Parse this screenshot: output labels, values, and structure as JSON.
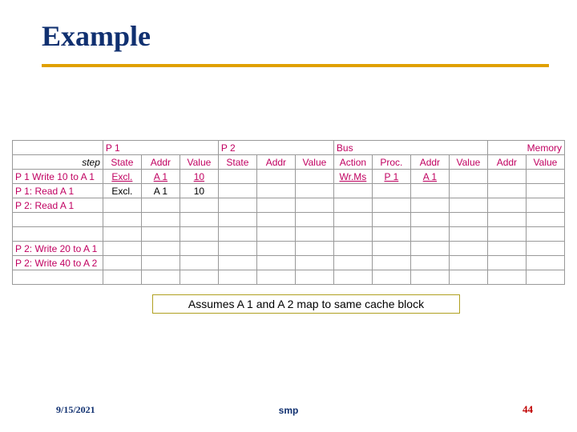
{
  "title": "Example",
  "group_headers": {
    "pre": "",
    "p1": "P 1",
    "p2": "P 2",
    "bus": "Bus",
    "mem": "Memory"
  },
  "col_headers": {
    "step": "step",
    "p1_state": "State",
    "p1_addr": "Addr",
    "p1_value": "Value",
    "p2_state": "State",
    "p2_addr": "Addr",
    "p2_value": "Value",
    "bus_action": "Action",
    "bus_proc": "Proc.",
    "bus_addr": "Addr",
    "bus_value": "Value",
    "mem_addr": "Addr",
    "mem_value": "Value"
  },
  "rows": [
    {
      "step": "P 1 Write 10 to A 1",
      "p1_state": "Excl.",
      "p1_addr": "A 1",
      "p1_value": "10",
      "p2_state": "",
      "p2_addr": "",
      "p2_value": "",
      "bus_action": "Wr.Ms",
      "bus_proc": "P 1",
      "bus_addr": "A 1",
      "bus_value": "",
      "mem_addr": "",
      "mem_value": "",
      "highlight": true
    },
    {
      "step": "P 1: Read A 1",
      "p1_state": "Excl.",
      "p1_addr": "A 1",
      "p1_value": "10",
      "p2_state": "",
      "p2_addr": "",
      "p2_value": "",
      "bus_action": "",
      "bus_proc": "",
      "bus_addr": "",
      "bus_value": "",
      "mem_addr": "",
      "mem_value": "",
      "highlight": false
    },
    {
      "step": "P 2: Read A 1",
      "p1_state": "",
      "p1_addr": "",
      "p1_value": "",
      "p2_state": "",
      "p2_addr": "",
      "p2_value": "",
      "bus_action": "",
      "bus_proc": "",
      "bus_addr": "",
      "bus_value": "",
      "mem_addr": "",
      "mem_value": "",
      "highlight": false
    },
    {
      "step": "",
      "p1_state": "",
      "p1_addr": "",
      "p1_value": "",
      "p2_state": "",
      "p2_addr": "",
      "p2_value": "",
      "bus_action": "",
      "bus_proc": "",
      "bus_addr": "",
      "bus_value": "",
      "mem_addr": "",
      "mem_value": "",
      "highlight": false
    },
    {
      "step": "",
      "p1_state": "",
      "p1_addr": "",
      "p1_value": "",
      "p2_state": "",
      "p2_addr": "",
      "p2_value": "",
      "bus_action": "",
      "bus_proc": "",
      "bus_addr": "",
      "bus_value": "",
      "mem_addr": "",
      "mem_value": "",
      "highlight": false
    },
    {
      "step": "P 2: Write 20 to A 1",
      "p1_state": "",
      "p1_addr": "",
      "p1_value": "",
      "p2_state": "",
      "p2_addr": "",
      "p2_value": "",
      "bus_action": "",
      "bus_proc": "",
      "bus_addr": "",
      "bus_value": "",
      "mem_addr": "",
      "mem_value": "",
      "highlight": false
    },
    {
      "step": "P 2: Write 40 to A 2",
      "p1_state": "",
      "p1_addr": "",
      "p1_value": "",
      "p2_state": "",
      "p2_addr": "",
      "p2_value": "",
      "bus_action": "",
      "bus_proc": "",
      "bus_addr": "",
      "bus_value": "",
      "mem_addr": "",
      "mem_value": "",
      "highlight": false
    },
    {
      "step": "",
      "p1_state": "",
      "p1_addr": "",
      "p1_value": "",
      "p2_state": "",
      "p2_addr": "",
      "p2_value": "",
      "bus_action": "",
      "bus_proc": "",
      "bus_addr": "",
      "bus_value": "",
      "mem_addr": "",
      "mem_value": "",
      "highlight": false
    }
  ],
  "assume_note": "Assumes A 1 and A 2 map to same cache block",
  "footer": {
    "date": "9/15/2021",
    "center": "smp",
    "page": "44"
  }
}
